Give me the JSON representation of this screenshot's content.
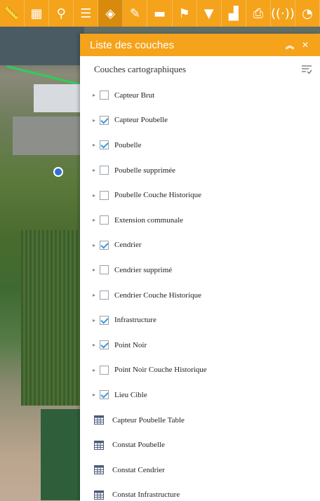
{
  "toolbar": {
    "tools": [
      {
        "icon": "ruler-icon",
        "glyph": "📏"
      },
      {
        "icon": "grid-icon",
        "glyph": "▦"
      },
      {
        "icon": "street-view-icon",
        "glyph": "⚲"
      },
      {
        "icon": "list-icon",
        "glyph": "☰"
      },
      {
        "icon": "layers-icon",
        "glyph": "◈",
        "active": true
      },
      {
        "icon": "edit-icon",
        "glyph": "✎"
      },
      {
        "icon": "comment-icon",
        "glyph": "▬"
      },
      {
        "icon": "pin-icon",
        "glyph": "⚑"
      },
      {
        "icon": "filter-icon",
        "glyph": "▼"
      },
      {
        "icon": "chart-icon",
        "glyph": "▟"
      },
      {
        "icon": "print-icon",
        "glyph": "⎙"
      },
      {
        "icon": "broadcast-icon",
        "glyph": "((·))"
      },
      {
        "icon": "dashboard-icon",
        "glyph": "◔"
      }
    ]
  },
  "panel": {
    "title": "Liste des couches",
    "collapse_glyph": "︽",
    "close_glyph": "✕",
    "section_title": "Couches cartographiques",
    "layers": [
      {
        "label": "Capteur Brut",
        "checked": false
      },
      {
        "label": "Capteur Poubelle",
        "checked": true
      },
      {
        "label": "Poubelle",
        "checked": true
      },
      {
        "label": "Poubelle supprimée",
        "checked": false
      },
      {
        "label": "Poubelle Couche Historique",
        "checked": false
      },
      {
        "label": "Extension communale",
        "checked": false
      },
      {
        "label": "Cendrier",
        "checked": true
      },
      {
        "label": "Cendrier supprimé",
        "checked": false
      },
      {
        "label": "Cendrier Couche Historique",
        "checked": false
      },
      {
        "label": "Infrastructure",
        "checked": true
      },
      {
        "label": "Point Noir",
        "checked": true
      },
      {
        "label": "Point Noir Couche Historique",
        "checked": false
      },
      {
        "label": "Lieu Cible",
        "checked": true
      }
    ],
    "tables": [
      {
        "label": "Capteur Poubelle Table"
      },
      {
        "label": "Constat Poubelle"
      },
      {
        "label": "Constat Cendrier"
      },
      {
        "label": "Constat Infrastructure"
      }
    ]
  }
}
